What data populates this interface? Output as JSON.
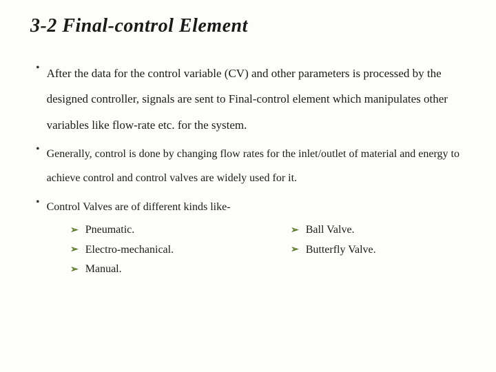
{
  "title": "3-2 Final-control Element",
  "bullets": [
    {
      "text": "After the data for the control variable (CV) and other parameters is processed by the designed controller, signals are sent to Final-control element which manipulates other variables like flow-rate etc. for the system."
    },
    {
      "text": "Generally, control is done by changing flow rates for the inlet/outlet  of material and energy to achieve control and control valves are widely used for it."
    },
    {
      "text": "Control Valves are of different kinds like-"
    }
  ],
  "subitems_left": [
    "Pneumatic.",
    "Electro-mechanical.",
    "Manual."
  ],
  "subitems_right": [
    "Ball Valve.",
    "Butterfly Valve."
  ]
}
